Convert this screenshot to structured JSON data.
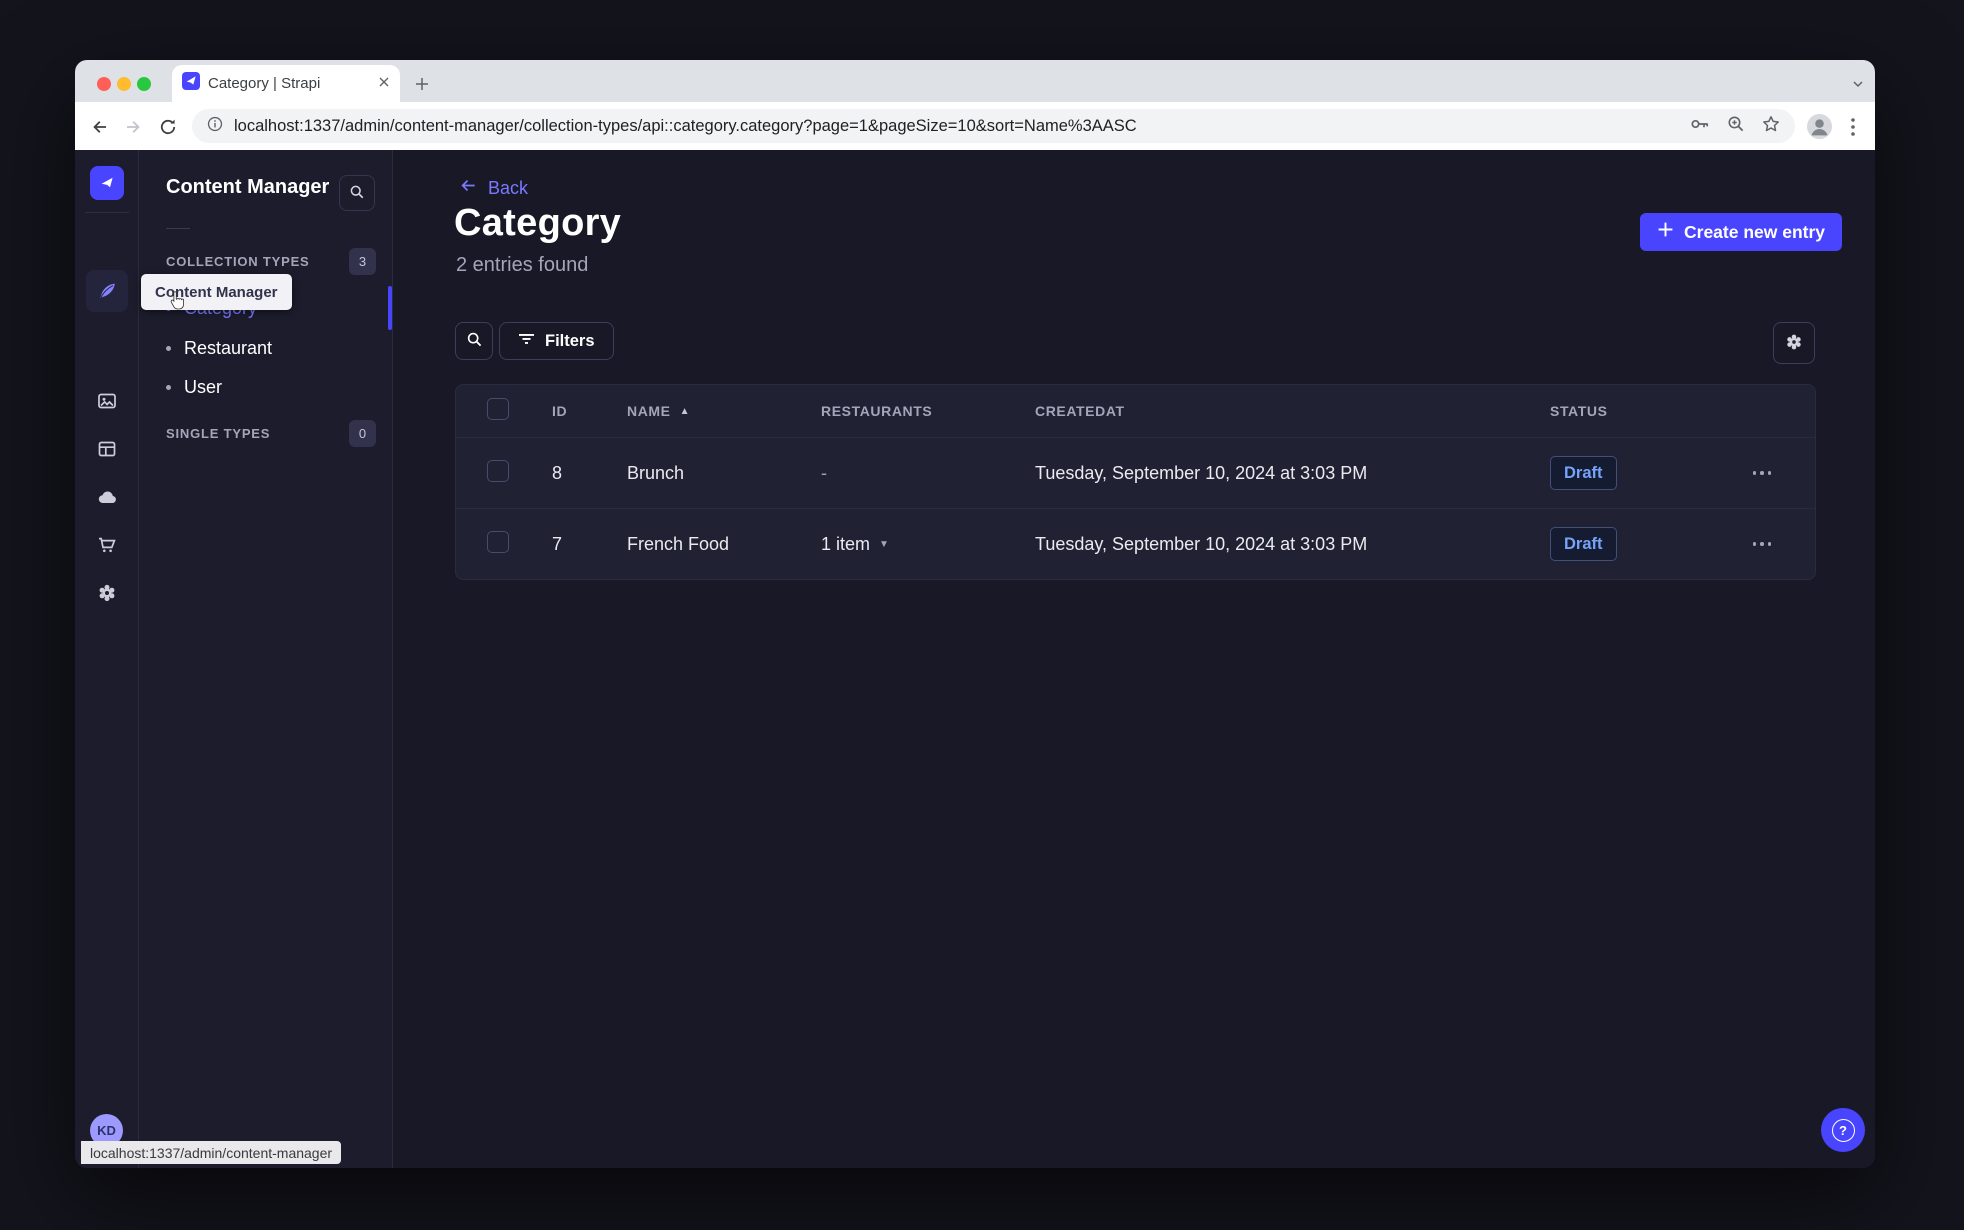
{
  "browser": {
    "tab_title": "Category | Strapi",
    "url": "localhost:1337/admin/content-manager/collection-types/api::category.category?page=1&pageSize=10&sort=Name%3AASC",
    "status_bar": "localhost:1337/admin/content-manager"
  },
  "rail": {
    "avatar_initials": "KD",
    "icons": [
      "home",
      "content-manager",
      "media-library",
      "content-type-builder",
      "cloud",
      "marketplace",
      "settings"
    ]
  },
  "sidebar": {
    "title": "Content Manager",
    "tooltip": "Content Manager",
    "collection_types_label": "COLLECTION TYPES",
    "collection_types_count": "3",
    "items": [
      {
        "label": "Category"
      },
      {
        "label": "Restaurant"
      },
      {
        "label": "User"
      }
    ],
    "single_types_label": "SINGLE TYPES",
    "single_types_count": "0"
  },
  "main": {
    "back_label": "Back",
    "title": "Category",
    "subtitle": "2 entries found",
    "create_button_label": "Create new entry",
    "filters_label": "Filters",
    "table": {
      "headers": [
        "ID",
        "NAME",
        "RESTAURANTS",
        "CREATEDAT",
        "STATUS"
      ],
      "rows": [
        {
          "id": "8",
          "name": "Brunch",
          "restaurants": "-",
          "created_at": "Tuesday, September 10, 2024 at 3:03 PM",
          "status": "Draft"
        },
        {
          "id": "7",
          "name": "French Food",
          "restaurants": "1 item",
          "created_at": "Tuesday, September 10, 2024 at 3:03 PM",
          "status": "Draft"
        }
      ]
    }
  },
  "icons": {
    "sort_asc": "▲",
    "chevron_down": "▼",
    "help": "?"
  },
  "colors": {
    "primary": "#4945ff",
    "primary_light": "#7b79ff",
    "background": "#181826",
    "surface": "#212134",
    "draft_text": "#75a4f9"
  }
}
